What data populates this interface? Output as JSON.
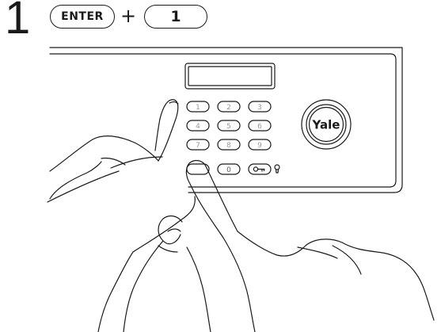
{
  "step": {
    "number": "1"
  },
  "instruction": {
    "key_enter": "ENTER",
    "plus": "+",
    "key_one": "1"
  },
  "keypad": {
    "keys": [
      "1",
      "2",
      "3",
      "4",
      "5",
      "6",
      "7",
      "8",
      "9",
      "*",
      "0",
      "key"
    ],
    "key_icon": "key-icon",
    "hint_icon": "bulb-icon"
  },
  "brand": {
    "logo_text": "Yale"
  },
  "colors": {
    "line": "#1a1a1a",
    "background": "#ffffff"
  }
}
